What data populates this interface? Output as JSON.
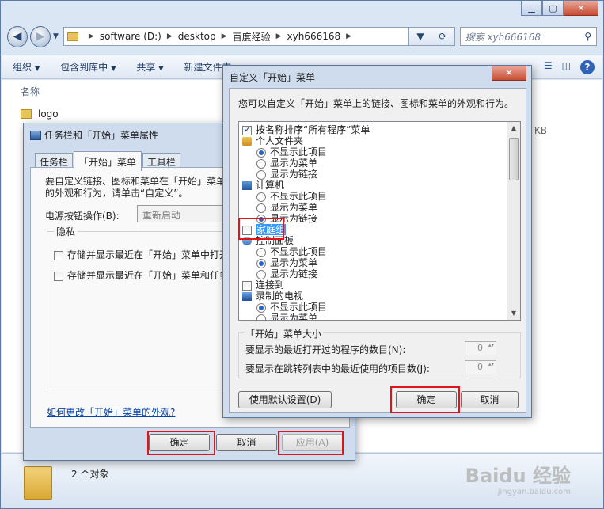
{
  "explorer": {
    "address": [
      "software (D:)",
      "desktop",
      "百度经验",
      "xyh666168"
    ],
    "search_placeholder": "搜索 xyh666168",
    "toolbar": [
      "组织",
      "包含到库中",
      "共享",
      "新建文件夹"
    ],
    "column_name": "名称",
    "file_name": "logo",
    "size_fragment": "KB",
    "item_count": "2 个对象"
  },
  "taskbar_dialog": {
    "title": "任务栏和「开始」菜单属性",
    "tabs": [
      "任务栏",
      "「开始」菜单",
      "工具栏"
    ],
    "description": "要自定义链接、图标和菜单在「开始」菜单中的外观和行为，请单击“自定义”。",
    "power_label": "电源按钮操作(B):",
    "power_value": "重新启动",
    "privacy_title": "隐私",
    "privacy_items": [
      "存储并显示最近在「开始」菜单中打开",
      "存储并显示最近在「开始」菜单和任务"
    ],
    "help_link": "如何更改「开始」菜单的外观?",
    "buttons": {
      "ok": "确定",
      "cancel": "取消",
      "apply": "应用(A)"
    }
  },
  "customize_dialog": {
    "title": "自定义「开始」菜单",
    "description": "您可以自定义「开始」菜单上的链接、图标和菜单的外观和行为。",
    "tree": [
      "按名称排序“所有程序”菜单",
      "个人文件夹",
      "不显示此项目",
      "显示为菜单",
      "显示为链接",
      "计算机",
      "不显示此项目",
      "显示为菜单",
      "显示为链接",
      "家庭组",
      "控制面板",
      "不显示此项目",
      "显示为菜单",
      "显示为链接",
      "连接到",
      "录制的电视",
      "不显示此项目",
      "显示为菜单"
    ],
    "size_title": "「开始」菜单大小",
    "recent_programs_label": "要显示的最近打开过的程序的数目(N):",
    "recent_programs_value": "0",
    "jump_list_label": "要显示在跳转列表中的最近使用的项目数(J):",
    "jump_list_value": "0",
    "buttons": {
      "defaults": "使用默认设置(D)",
      "ok": "确定",
      "cancel": "取消"
    }
  },
  "watermark": {
    "text": "Baidu 经验",
    "subtext": "jingyan.baidu.com"
  },
  "colors": {
    "highlight_box": "#e1141c",
    "selection": "#3399ff"
  }
}
